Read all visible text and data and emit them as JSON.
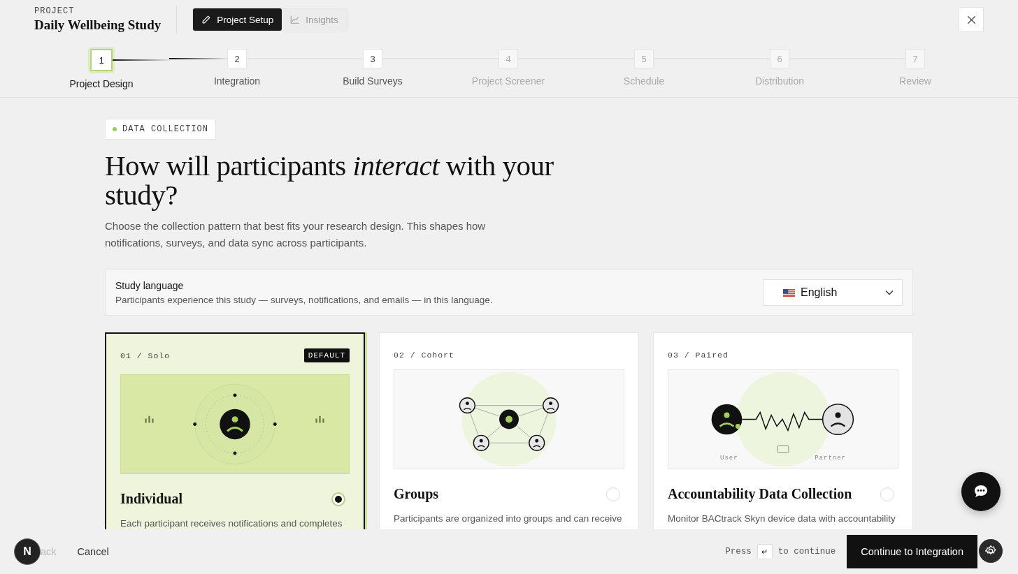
{
  "header": {
    "eyebrow": "PROJECT",
    "title": "Daily Wellbeing Study",
    "tabs": [
      {
        "label": "Project Setup",
        "selected": true,
        "disabled": false
      },
      {
        "label": "Insights",
        "selected": false,
        "disabled": true
      }
    ]
  },
  "steps": [
    {
      "number": "1",
      "label": "Project Design",
      "current": true,
      "disabled": false
    },
    {
      "number": "2",
      "label": "Integration",
      "current": false,
      "disabled": false
    },
    {
      "number": "3",
      "label": "Build Surveys",
      "current": false,
      "disabled": false
    },
    {
      "number": "4",
      "label": "Project Screener",
      "current": false,
      "disabled": true
    },
    {
      "number": "5",
      "label": "Schedule",
      "current": false,
      "disabled": true
    },
    {
      "number": "6",
      "label": "Distribution",
      "current": false,
      "disabled": true
    },
    {
      "number": "7",
      "label": "Review",
      "current": false,
      "disabled": true
    }
  ],
  "section_tag": "DATA COLLECTION",
  "heading": "How will participants *interact* with your study?",
  "intro": "Choose the collection pattern that best fits your research design. This shapes how notifications, surveys, and data sync across participants.",
  "language": {
    "title": "Study language",
    "description": "Participants experience this study — surveys, notifications, and emails — in this language.",
    "value": "English"
  },
  "cards": [
    {
      "tag": "01 / Solo",
      "badge": "DEFAULT",
      "kind": "solo",
      "title": "Individual",
      "description": "Each participant receives notifications and completes",
      "selected": true
    },
    {
      "tag": "02 / Cohort",
      "kind": "cohort",
      "title": "Groups",
      "description": "Participants are organized into groups and can receive",
      "selected": false
    },
    {
      "tag": "03 / Paired",
      "kind": "paired",
      "title": "Accountability Data Collection",
      "description": "Monitor BACtrack Skyn device data with accountability",
      "selected": false,
      "labels": [
        "User",
        "Partner"
      ]
    }
  ],
  "avatar": "N",
  "footer": {
    "back": "ack",
    "cancel": "Cancel",
    "hint_before": "Press",
    "key": "↵",
    "hint_after": "to continue",
    "primary": "Continue to Integration"
  }
}
